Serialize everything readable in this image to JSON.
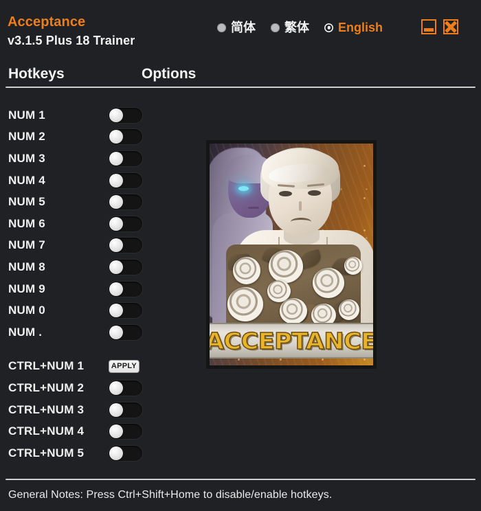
{
  "window": {
    "app_title": "Acceptance",
    "version_line": "v3.1.5 Plus 18 Trainer",
    "accent_color": "#ef7d1a",
    "background_color": "#1f2124",
    "minimize_icon": "minimize-icon",
    "close_icon": "close-icon"
  },
  "languages": [
    {
      "label": "简体",
      "selected": false
    },
    {
      "label": "繁体",
      "selected": false
    },
    {
      "label": "English",
      "selected": true
    }
  ],
  "columns": {
    "hotkeys": "Hotkeys",
    "options": "Options"
  },
  "rows": [
    {
      "hotkey": "NUM 1",
      "control": "toggle",
      "state": "off"
    },
    {
      "hotkey": "NUM 2",
      "control": "toggle",
      "state": "off"
    },
    {
      "hotkey": "NUM 3",
      "control": "toggle",
      "state": "off"
    },
    {
      "hotkey": "NUM 4",
      "control": "toggle",
      "state": "off"
    },
    {
      "hotkey": "NUM 5",
      "control": "toggle",
      "state": "off"
    },
    {
      "hotkey": "NUM 6",
      "control": "toggle",
      "state": "off"
    },
    {
      "hotkey": "NUM 7",
      "control": "toggle",
      "state": "off"
    },
    {
      "hotkey": "NUM 8",
      "control": "toggle",
      "state": "off"
    },
    {
      "hotkey": "NUM 9",
      "control": "toggle",
      "state": "off"
    },
    {
      "hotkey": "NUM 0",
      "control": "toggle",
      "state": "off"
    },
    {
      "hotkey": "NUM .",
      "control": "toggle",
      "state": "off"
    },
    {
      "hotkey": "CTRL+NUM 1",
      "control": "button",
      "label": "APPLY"
    },
    {
      "hotkey": "CTRL+NUM 2",
      "control": "toggle",
      "state": "off"
    },
    {
      "hotkey": "CTRL+NUM 3",
      "control": "toggle",
      "state": "off"
    },
    {
      "hotkey": "CTRL+NUM 4",
      "control": "toggle",
      "state": "off"
    },
    {
      "hotkey": "CTRL+NUM 5",
      "control": "toggle",
      "state": "off"
    }
  ],
  "cover": {
    "title_text": "ACCEPTANCE",
    "alt": "game-cover-art"
  },
  "footer": {
    "note": "General Notes: Press Ctrl+Shift+Home to disable/enable hotkeys."
  }
}
